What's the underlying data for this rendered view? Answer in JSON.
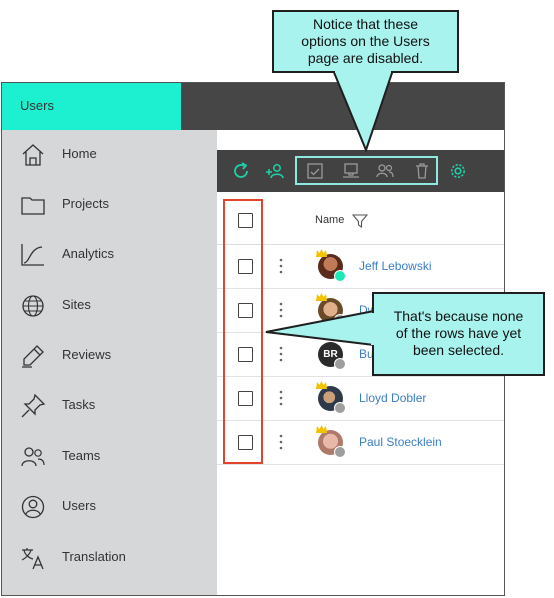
{
  "app": {
    "tab_label": "Users"
  },
  "sidebar": {
    "items": [
      {
        "label": "Home",
        "icon": "home-icon"
      },
      {
        "label": "Projects",
        "icon": "folder-icon"
      },
      {
        "label": "Analytics",
        "icon": "analytics-icon"
      },
      {
        "label": "Sites",
        "icon": "globe-icon"
      },
      {
        "label": "Reviews",
        "icon": "pen-icon"
      },
      {
        "label": "Tasks",
        "icon": "pin-icon"
      },
      {
        "label": "Teams",
        "icon": "teams-icon"
      },
      {
        "label": "Users",
        "icon": "user-icon"
      },
      {
        "label": "Translation",
        "icon": "translate-icon"
      }
    ]
  },
  "toolbar": {
    "icons": [
      "refresh-icon",
      "add-user-icon",
      "checklist-icon",
      "computer-icon",
      "users-icon",
      "trash-icon",
      "gear-icon"
    ],
    "accent": "#1fd1a8"
  },
  "table": {
    "column_name": "Name",
    "rows": [
      {
        "name": "Jeff Lebowski",
        "avatar_initials": "",
        "status": "online"
      },
      {
        "name": "Dw",
        "avatar_initials": "",
        "status": "offline"
      },
      {
        "name": "Bu",
        "avatar_initials": "BR",
        "status": "offline"
      },
      {
        "name": "Lloyd Dobler",
        "avatar_initials": "",
        "status": "offline"
      },
      {
        "name": "Paul Stoecklein",
        "avatar_initials": "",
        "status": "offline"
      }
    ]
  },
  "callouts": {
    "top": [
      "Notice that these",
      "options on the Users",
      "page are disabled."
    ],
    "right": [
      "That's because none",
      "of the rows have yet",
      "been selected."
    ]
  },
  "colors": {
    "callout_bg": "#a8f3ee",
    "highlight": "#e2432a",
    "online": "#1de9b6",
    "offline": "#9e9e9e",
    "link": "#3a7fc4"
  }
}
